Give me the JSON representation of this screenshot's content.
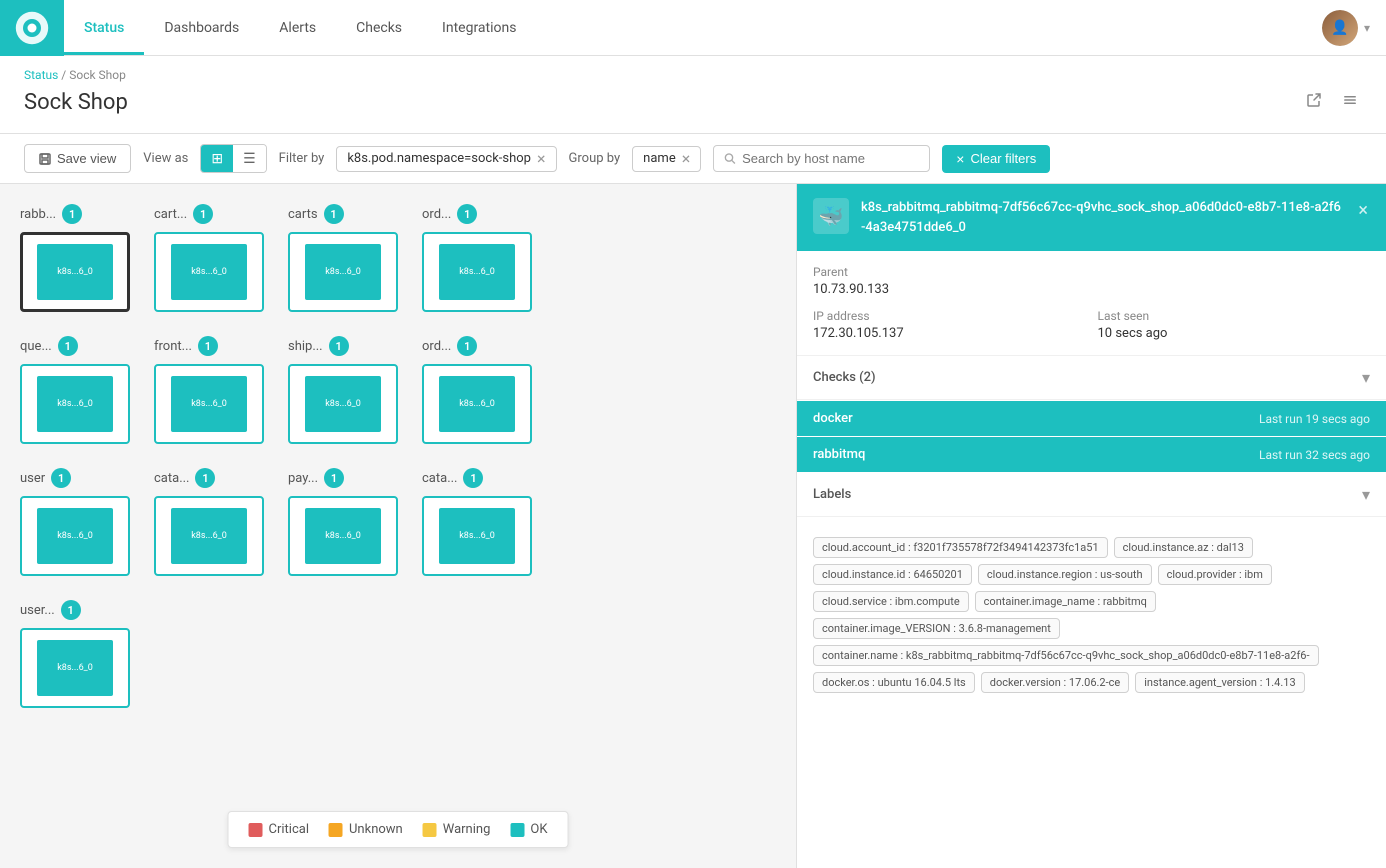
{
  "app": {
    "logo_alt": "Datadog"
  },
  "nav": {
    "links": [
      {
        "id": "status",
        "label": "Status",
        "active": true
      },
      {
        "id": "dashboards",
        "label": "Dashboards",
        "active": false
      },
      {
        "id": "alerts",
        "label": "Alerts",
        "active": false
      },
      {
        "id": "checks",
        "label": "Checks",
        "active": false
      },
      {
        "id": "integrations",
        "label": "Integrations",
        "active": false
      }
    ]
  },
  "breadcrumb": {
    "parent": "Status",
    "current": "Sock Shop"
  },
  "page": {
    "title": "Sock Shop"
  },
  "toolbar": {
    "save_view_label": "Save view",
    "view_as_label": "View as",
    "filter_by_label": "Filter by",
    "filter_value": "k8s.pod.namespace=sock-shop",
    "group_by_label": "Group by",
    "group_by_value": "name",
    "search_placeholder": "Search by host name",
    "clear_filters_label": "Clear filters"
  },
  "grid": {
    "groups": [
      {
        "id": "rabb",
        "label": "rabb...",
        "count": 1,
        "host_label": "k8s...6_0",
        "selected": true
      },
      {
        "id": "cart",
        "label": "cart...",
        "count": 1,
        "host_label": "k8s...6_0",
        "selected": false
      },
      {
        "id": "carts",
        "label": "carts",
        "count": 1,
        "host_label": "k8s...6_0",
        "selected": false
      },
      {
        "id": "ord1",
        "label": "ord...",
        "count": 1,
        "host_label": "k8s...6_0",
        "selected": false
      },
      {
        "id": "que",
        "label": "que...",
        "count": 1,
        "host_label": "k8s...6_0",
        "selected": false
      },
      {
        "id": "front",
        "label": "front...",
        "count": 1,
        "host_label": "k8s...6_0",
        "selected": false
      },
      {
        "id": "ship",
        "label": "ship...",
        "count": 1,
        "host_label": "k8s...6_0",
        "selected": false
      },
      {
        "id": "ord2",
        "label": "ord...",
        "count": 1,
        "host_label": "k8s...6_0",
        "selected": false
      },
      {
        "id": "user",
        "label": "user",
        "count": 1,
        "host_label": "k8s...6_0",
        "selected": false
      },
      {
        "id": "cata1",
        "label": "cata...",
        "count": 1,
        "host_label": "k8s...6_0",
        "selected": false
      },
      {
        "id": "pay",
        "label": "pay...",
        "count": 1,
        "host_label": "k8s...6_0",
        "selected": false
      },
      {
        "id": "cata2",
        "label": "cata...",
        "count": 1,
        "host_label": "k8s...6_0",
        "selected": false
      },
      {
        "id": "userdot",
        "label": "user...",
        "count": 1,
        "host_label": "k8s...6_0",
        "selected": false
      }
    ]
  },
  "legend": {
    "items": [
      {
        "label": "Critical",
        "color": "#e05c5c"
      },
      {
        "label": "Unknown",
        "color": "#f5a623"
      },
      {
        "label": "Warning",
        "color": "#f5c842"
      },
      {
        "label": "OK",
        "color": "#1DBFBF"
      }
    ]
  },
  "detail_panel": {
    "title": "k8s_rabbitmq_rabbitmq-7df56c67cc-q9vhc_sock_shop_a06d0dc0-e8b7-11e8-a2f6-4a3e4751dde6_0",
    "parent_label": "Parent",
    "parent_value": "10.73.90.133",
    "ip_label": "IP address",
    "ip_value": "172.30.105.137",
    "last_seen_label": "Last seen",
    "last_seen_value": "10 secs ago",
    "checks_label": "Checks (2)",
    "checks": [
      {
        "name": "docker",
        "time": "Last run 19 secs ago"
      },
      {
        "name": "rabbitmq",
        "time": "Last run 32 secs ago"
      }
    ],
    "labels_label": "Labels",
    "labels": [
      {
        "key": "cloud.account_id",
        "value": "f3201f735578f72f3494142373fc1a51"
      },
      {
        "key": "cloud.instance.az",
        "value": "dal13"
      },
      {
        "key": "cloud.instance.id",
        "value": "64650201"
      },
      {
        "key": "cloud.instance.region",
        "value": "us-south"
      },
      {
        "key": "cloud.provider",
        "value": "ibm"
      },
      {
        "key": "cloud.service",
        "value": "ibm.compute"
      },
      {
        "key": "container.image_name",
        "value": "rabbitmq"
      },
      {
        "key": "container.image_VERSION",
        "value": "3.6.8-management"
      },
      {
        "key": "container.name",
        "value": "k8s_rabbitmq_rabbitmq-7df56c67cc-q9vhc_sock_shop_a06d0dc0-e8b7-11e8-a2f6-"
      },
      {
        "key": "docker.os",
        "value": "ubuntu 16.04.5 lts"
      },
      {
        "key": "docker.version",
        "value": "17.06.2-ce"
      },
      {
        "key": "instance.agent_version",
        "value": "1.4.13"
      }
    ]
  },
  "zoom": {
    "plus": "+",
    "minus": "−"
  }
}
